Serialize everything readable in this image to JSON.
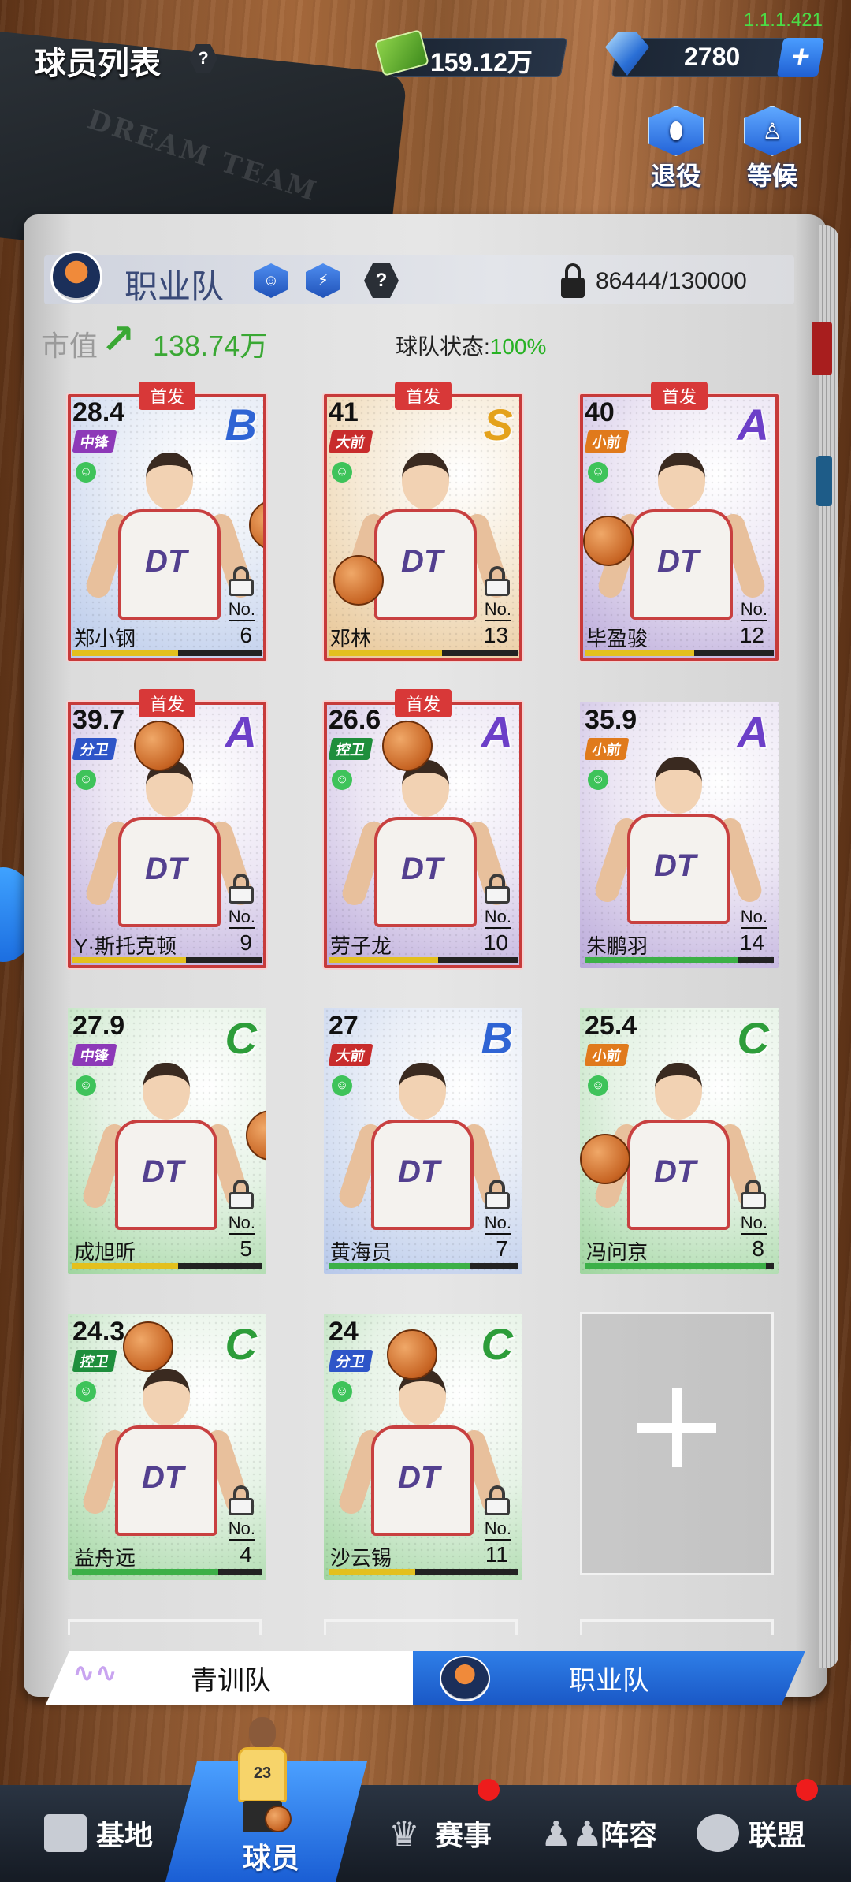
{
  "version": "1.1.1.421",
  "header": {
    "title": "球员列表",
    "help": "?"
  },
  "currency": {
    "money": "159.12万",
    "gems": "2780",
    "add_label": "+"
  },
  "buttons": {
    "retire": "退役",
    "waiting": "等候"
  },
  "notebook_text": "DREAM TEAM",
  "team": {
    "name": "职业队",
    "help": "?",
    "capacity": "86444/130000",
    "market_label": "市值",
    "market_value": "138.74万",
    "status_label": "球队状态:",
    "status_value": "100%"
  },
  "cards": [
    {
      "score": "28.4",
      "position": "中锋",
      "grade": "B",
      "name": "郑小钢",
      "no_label": "No.",
      "number": "6",
      "starter": "首发",
      "is_starter": true,
      "hp": 0.56
    },
    {
      "score": "41",
      "position": "大前",
      "grade": "S",
      "name": "邓林",
      "no_label": "No.",
      "number": "13",
      "starter": "首发",
      "is_starter": true,
      "hp": 0.6
    },
    {
      "score": "40",
      "position": "小前",
      "grade": "A",
      "name": "毕盈骏",
      "no_label": "No.",
      "number": "12",
      "starter": "首发",
      "is_starter": true,
      "hp": 0.58
    },
    {
      "score": "39.7",
      "position": "分卫",
      "grade": "A",
      "name": "Y·斯托克顿",
      "no_label": "No.",
      "number": "9",
      "starter": "首发",
      "is_starter": true,
      "hp": 0.6
    },
    {
      "score": "26.6",
      "position": "控卫",
      "grade": "A",
      "name": "劳子龙",
      "no_label": "No.",
      "number": "10",
      "starter": "首发",
      "is_starter": true,
      "hp": 0.58
    },
    {
      "score": "35.9",
      "position": "小前",
      "grade": "A",
      "name": "朱鹏羽",
      "no_label": "No.",
      "number": "14",
      "starter": "",
      "is_starter": false,
      "hp": 0.81
    },
    {
      "score": "27.9",
      "position": "中锋",
      "grade": "C",
      "name": "成旭昕",
      "no_label": "No.",
      "number": "5",
      "starter": "",
      "is_starter": false,
      "hp": 0.56
    },
    {
      "score": "27",
      "position": "大前",
      "grade": "B",
      "name": "黄海员",
      "no_label": "No.",
      "number": "7",
      "starter": "",
      "is_starter": false,
      "hp": 0.75
    },
    {
      "score": "25.4",
      "position": "小前",
      "grade": "C",
      "name": "冯问京",
      "no_label": "No.",
      "number": "8",
      "starter": "",
      "is_starter": false,
      "hp": 0.96
    },
    {
      "score": "24.3",
      "position": "控卫",
      "grade": "C",
      "name": "益舟远",
      "no_label": "No.",
      "number": "4",
      "starter": "",
      "is_starter": false,
      "hp": 0.77
    },
    {
      "score": "24",
      "position": "分卫",
      "grade": "C",
      "name": "沙云锡",
      "no_label": "No.",
      "number": "11",
      "starter": "",
      "is_starter": false,
      "hp": 0.46
    }
  ],
  "add_slot": "+",
  "subtabs": {
    "youth": "青训队",
    "pro": "职业队"
  },
  "nav": {
    "base": "基地",
    "players": "球员",
    "events": "赛事",
    "lineup": "阵容",
    "league": "联盟"
  },
  "jersey_number": "23",
  "colors": {
    "start_badge": "#d83838",
    "accent": "#2f7fe8",
    "status_green": "#28b224",
    "market_green": "#3aa834",
    "version_green": "#4cdc46"
  }
}
